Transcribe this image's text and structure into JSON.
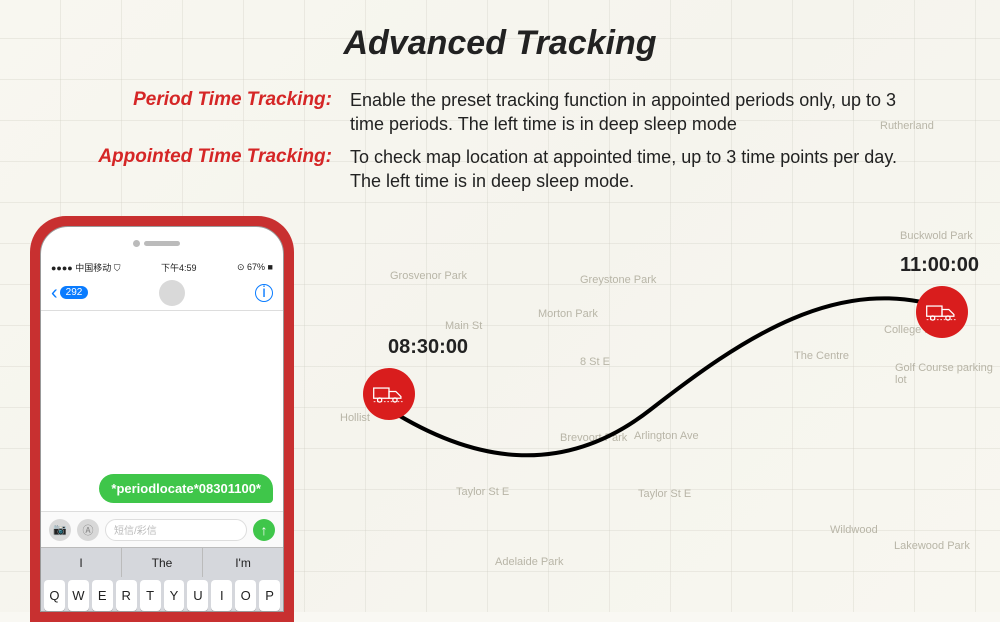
{
  "title": "Advanced Tracking",
  "features": [
    {
      "label": "Period Time Tracking:",
      "description": "Enable the preset tracking function in appointed periods only, up to 3 time periods. The left time is in deep sleep mode"
    },
    {
      "label": "Appointed Time Tracking:",
      "description": "To check map location at appointed time, up to 3 time points per day. The left time is in deep sleep mode."
    }
  ],
  "phone": {
    "status_carrier": "●●●● 中国移动 ⛉",
    "status_time": "下午4:59",
    "status_battery": "⊙ 67% ■",
    "back_count": "292",
    "message_bubble": "*periodlocate*08301100*",
    "compose_placeholder": "短信/彩信",
    "predictive": [
      "I",
      "The",
      "I'm"
    ],
    "keyboard_row": [
      "Q",
      "W",
      "E",
      "R",
      "T",
      "Y",
      "U",
      "I",
      "O",
      "P"
    ]
  },
  "route": {
    "point_a_time": "08:30:00",
    "point_b_time": "11:00:00"
  },
  "map_labels": {
    "a": "Main St",
    "b": "Morton Park",
    "c": "Greystone Park",
    "d": "The Centre",
    "e": "Brevoort Park",
    "f": "Arlington Ave",
    "g": "Taylor St E",
    "h": "8 St E",
    "i": "Wildwood",
    "j": "Lakewood Park",
    "k": "College Park",
    "l": "Hollist",
    "m": "Golf Course parking lot",
    "n": "Grosvenor Park",
    "o": "Buckwold Park",
    "p": "Rutherland",
    "q": "Taylor St E",
    "r": "Adelaide Park"
  }
}
